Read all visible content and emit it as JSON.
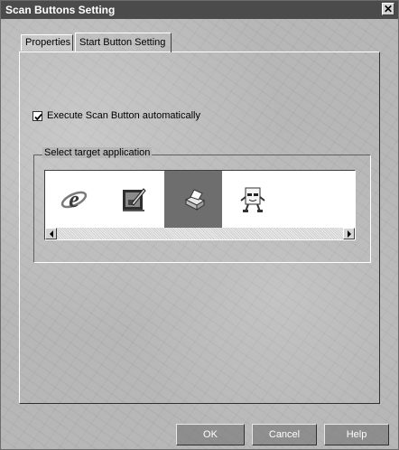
{
  "window": {
    "title": "Scan Buttons Setting",
    "close_glyph": "✕"
  },
  "tabs": [
    {
      "label": "Properties",
      "active": false
    },
    {
      "label": "Start Button Setting",
      "active": true
    }
  ],
  "checkbox": {
    "label": "Execute Scan Button automatically",
    "checked": true
  },
  "group": {
    "legend": "Select target application",
    "apps": [
      {
        "icon": "internet-explorer-icon",
        "selected": false
      },
      {
        "icon": "image-editor-icon",
        "selected": false
      },
      {
        "icon": "printer-icon",
        "selected": true
      },
      {
        "icon": "fax-character-icon",
        "selected": false
      }
    ]
  },
  "buttons": {
    "ok": "OK",
    "cancel": "Cancel",
    "help": "Help"
  },
  "colors": {
    "titlebar": "#4b4b4b",
    "selected_app": "#6e6e6e"
  }
}
